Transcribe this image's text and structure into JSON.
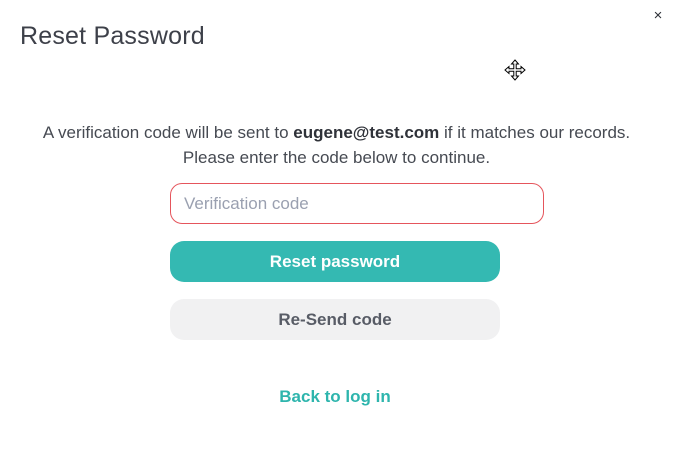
{
  "dialog": {
    "title": "Reset Password",
    "close_label": "×"
  },
  "message": {
    "before_email": "A verification code will be sent to ",
    "email": "eugene@test.com",
    "after_email": " if it matches our records. Please enter the code below to continue."
  },
  "form": {
    "code_value": "",
    "code_placeholder": "Verification code",
    "reset_label": "Reset password",
    "resend_label": "Re-Send code",
    "back_label": "Back to log in"
  },
  "icons": {
    "close": "close-icon",
    "cursor": "move-cursor-icon"
  },
  "colors": {
    "accent": "#34b9b2",
    "link": "#2eb5ad",
    "input_error_border": "#e5555c",
    "secondary_button": "#f1f1f2",
    "text": "#464a52"
  }
}
